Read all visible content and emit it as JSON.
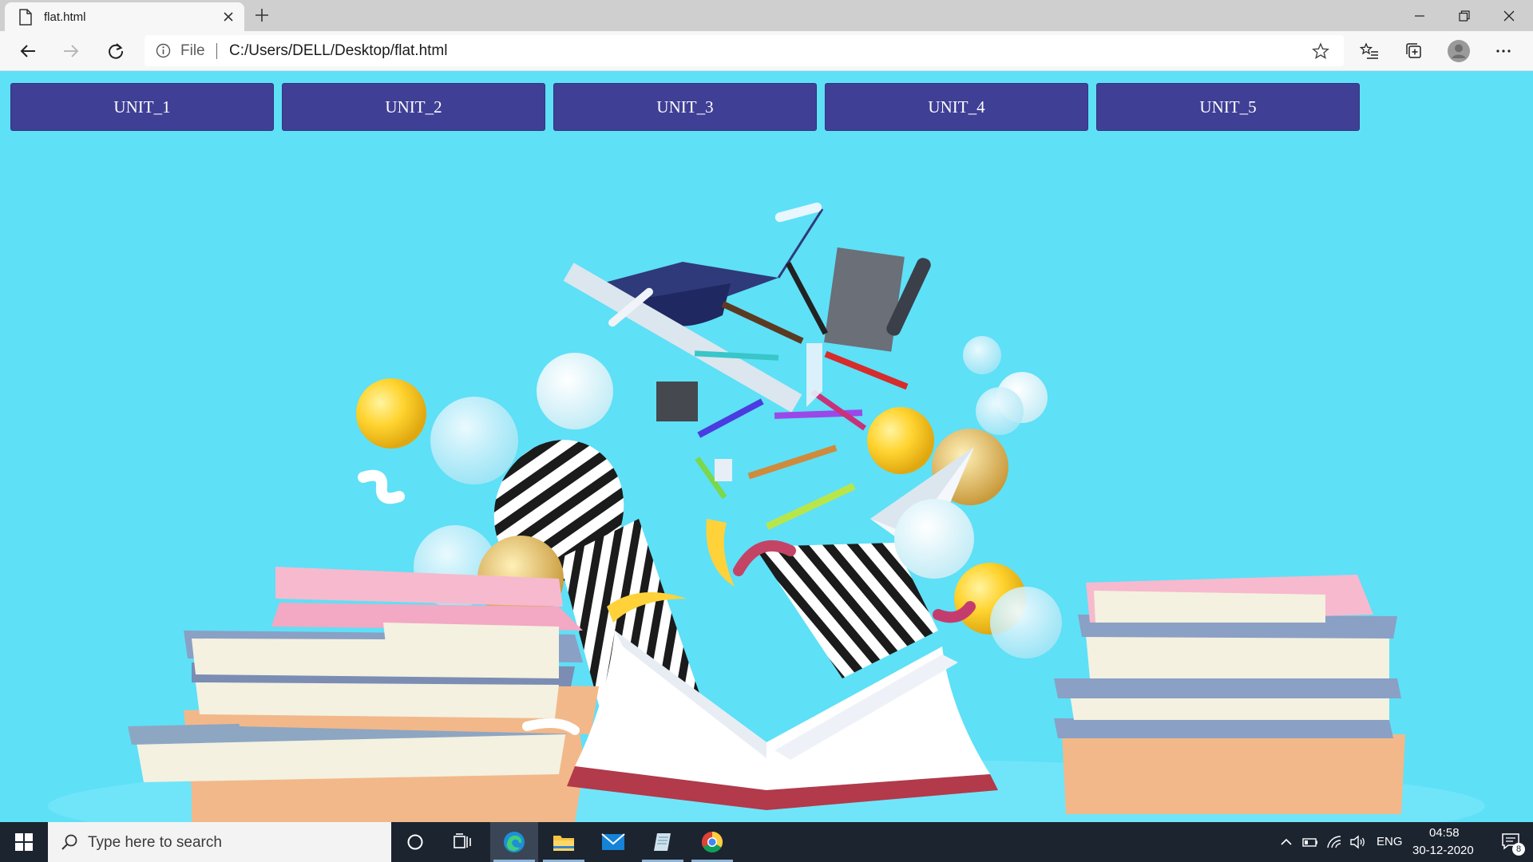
{
  "browser": {
    "tab_title": "flat.html",
    "address_scheme": "File",
    "address_url": "C:/Users/DELL/Desktop/flat.html"
  },
  "page": {
    "background_color": "#5ee0f7",
    "button_color": "#3f3f96",
    "units": [
      {
        "label": "UNIT_1"
      },
      {
        "label": "UNIT_2"
      },
      {
        "label": "UNIT_3"
      },
      {
        "label": "UNIT_4"
      },
      {
        "label": "UNIT_5"
      }
    ],
    "background_image": "education-illustration"
  },
  "taskbar": {
    "search_placeholder": "Type here to search",
    "language": "ENG",
    "time": "04:58",
    "date": "30-12-2020",
    "notification_count": "8"
  }
}
